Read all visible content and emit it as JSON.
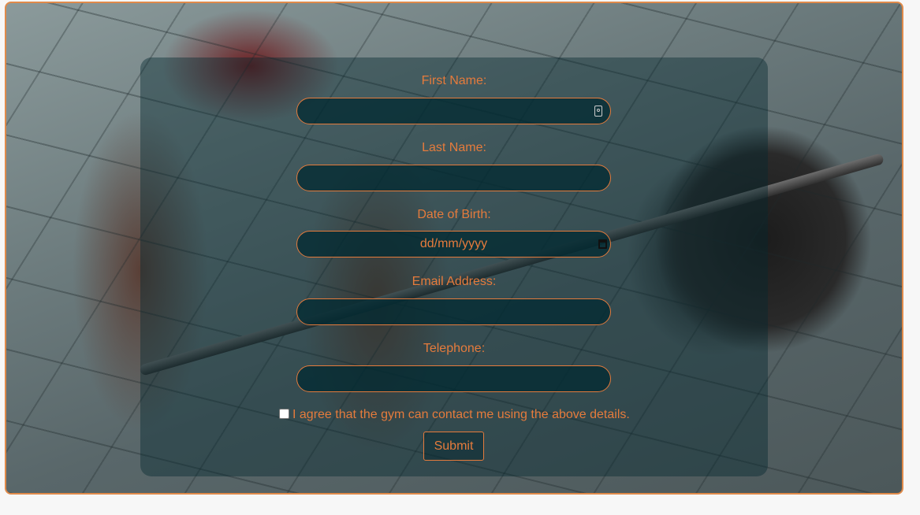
{
  "form": {
    "first_name": {
      "label": "First Name:",
      "value": ""
    },
    "last_name": {
      "label": "Last Name:",
      "value": ""
    },
    "dob": {
      "label": "Date of Birth:",
      "placeholder": "dd/mm/yyyy"
    },
    "email": {
      "label": "Email Address:",
      "value": ""
    },
    "telephone": {
      "label": "Telephone:",
      "value": ""
    },
    "consent_label": "I agree that the gym can contact me using the above details.",
    "consent_checked": false,
    "submit_label": "Submit"
  },
  "icons": {
    "autofill": "contact-card-icon",
    "date": "calendar-icon"
  },
  "colors": {
    "accent": "#e57b3c",
    "panel": "#05282f"
  }
}
